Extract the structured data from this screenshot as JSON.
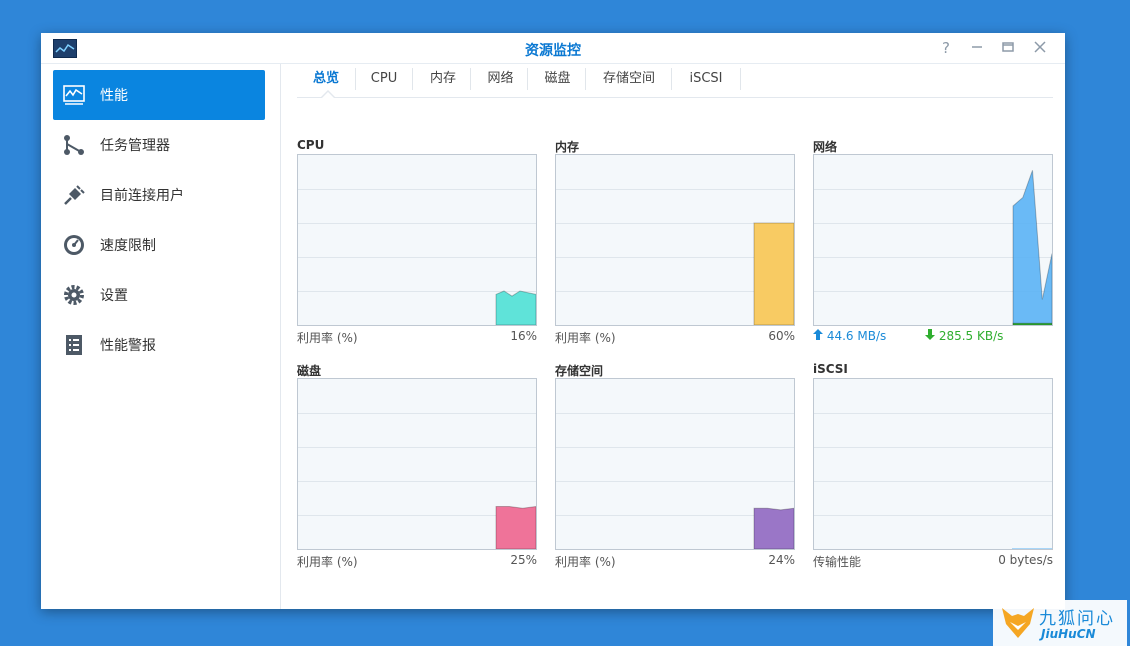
{
  "window": {
    "title": "资源监控",
    "controls": [
      "help-icon",
      "minimize-icon",
      "maximize-icon",
      "close-icon"
    ],
    "accent": "#0a85e0"
  },
  "sidebar": {
    "items": [
      {
        "label": "性能",
        "icon": "performance-icon",
        "active": true
      },
      {
        "label": "任务管理器",
        "icon": "task-manager-icon",
        "active": false
      },
      {
        "label": "目前连接用户",
        "icon": "plug-icon",
        "active": false
      },
      {
        "label": "速度限制",
        "icon": "speedometer-icon",
        "active": false
      },
      {
        "label": "设置",
        "icon": "gear-icon",
        "active": false
      },
      {
        "label": "性能警报",
        "icon": "alert-list-icon",
        "active": false
      }
    ]
  },
  "tabs": [
    {
      "label": "总览",
      "active": true
    },
    {
      "label": "CPU",
      "active": false
    },
    {
      "label": "内存",
      "active": false
    },
    {
      "label": "网络",
      "active": false
    },
    {
      "label": "磁盘",
      "active": false
    },
    {
      "label": "存储空间",
      "active": false
    },
    {
      "label": "iSCSI",
      "active": false
    }
  ],
  "panels": {
    "cpu": {
      "title": "CPU",
      "footer_label": "利用率 (%)",
      "footer_value": "16%",
      "color": "#5fe3d9"
    },
    "memory": {
      "title": "内存",
      "footer_label": "利用率 (%)",
      "footer_value": "60%",
      "color": "#f8cb63"
    },
    "network": {
      "title": "网络",
      "upload": "44.6 MB/s",
      "download": "285.5 KB/s",
      "upload_color": "#1a8ad8",
      "download_color": "#2fae2f",
      "color": "#5bb3f5"
    },
    "disk": {
      "title": "磁盘",
      "footer_label": "利用率 (%)",
      "footer_value": "25%",
      "color": "#ef7399"
    },
    "volume": {
      "title": "存储空间",
      "footer_label": "利用率 (%)",
      "footer_value": "24%",
      "color": "#9a76c7"
    },
    "iscsi": {
      "title": "iSCSI",
      "footer_label": "传输性能",
      "footer_value": "0 bytes/s"
    }
  },
  "chart_data": [
    {
      "type": "area",
      "panel": "CPU",
      "ylabel": "利用率 (%)",
      "ylim": [
        0,
        100
      ],
      "values": [
        18,
        20,
        17,
        20,
        19,
        18
      ]
    },
    {
      "type": "area",
      "panel": "内存",
      "ylabel": "利用率 (%)",
      "ylim": [
        0,
        100
      ],
      "values": [
        60,
        60,
        60,
        60,
        60,
        60
      ]
    },
    {
      "type": "area",
      "panel": "网络",
      "series": [
        {
          "values": [
            70,
            75,
            91,
            15,
            42
          ]
        },
        {
          "values": [
            1,
            1,
            1,
            1,
            1
          ]
        }
      ]
    },
    {
      "type": "area",
      "panel": "磁盘",
      "ylabel": "利用率 (%)",
      "ylim": [
        0,
        100
      ],
      "values": [
        25,
        25,
        24,
        25
      ]
    },
    {
      "type": "area",
      "panel": "存储空间",
      "ylabel": "利用率 (%)",
      "ylim": [
        0,
        100
      ],
      "values": [
        24,
        24,
        23,
        24
      ]
    },
    {
      "type": "area",
      "panel": "iSCSI",
      "ylabel": "传输性能",
      "values": [
        0,
        0
      ]
    }
  ],
  "watermark": {
    "cn": "九狐问心",
    "en": "JiuHuCN"
  }
}
